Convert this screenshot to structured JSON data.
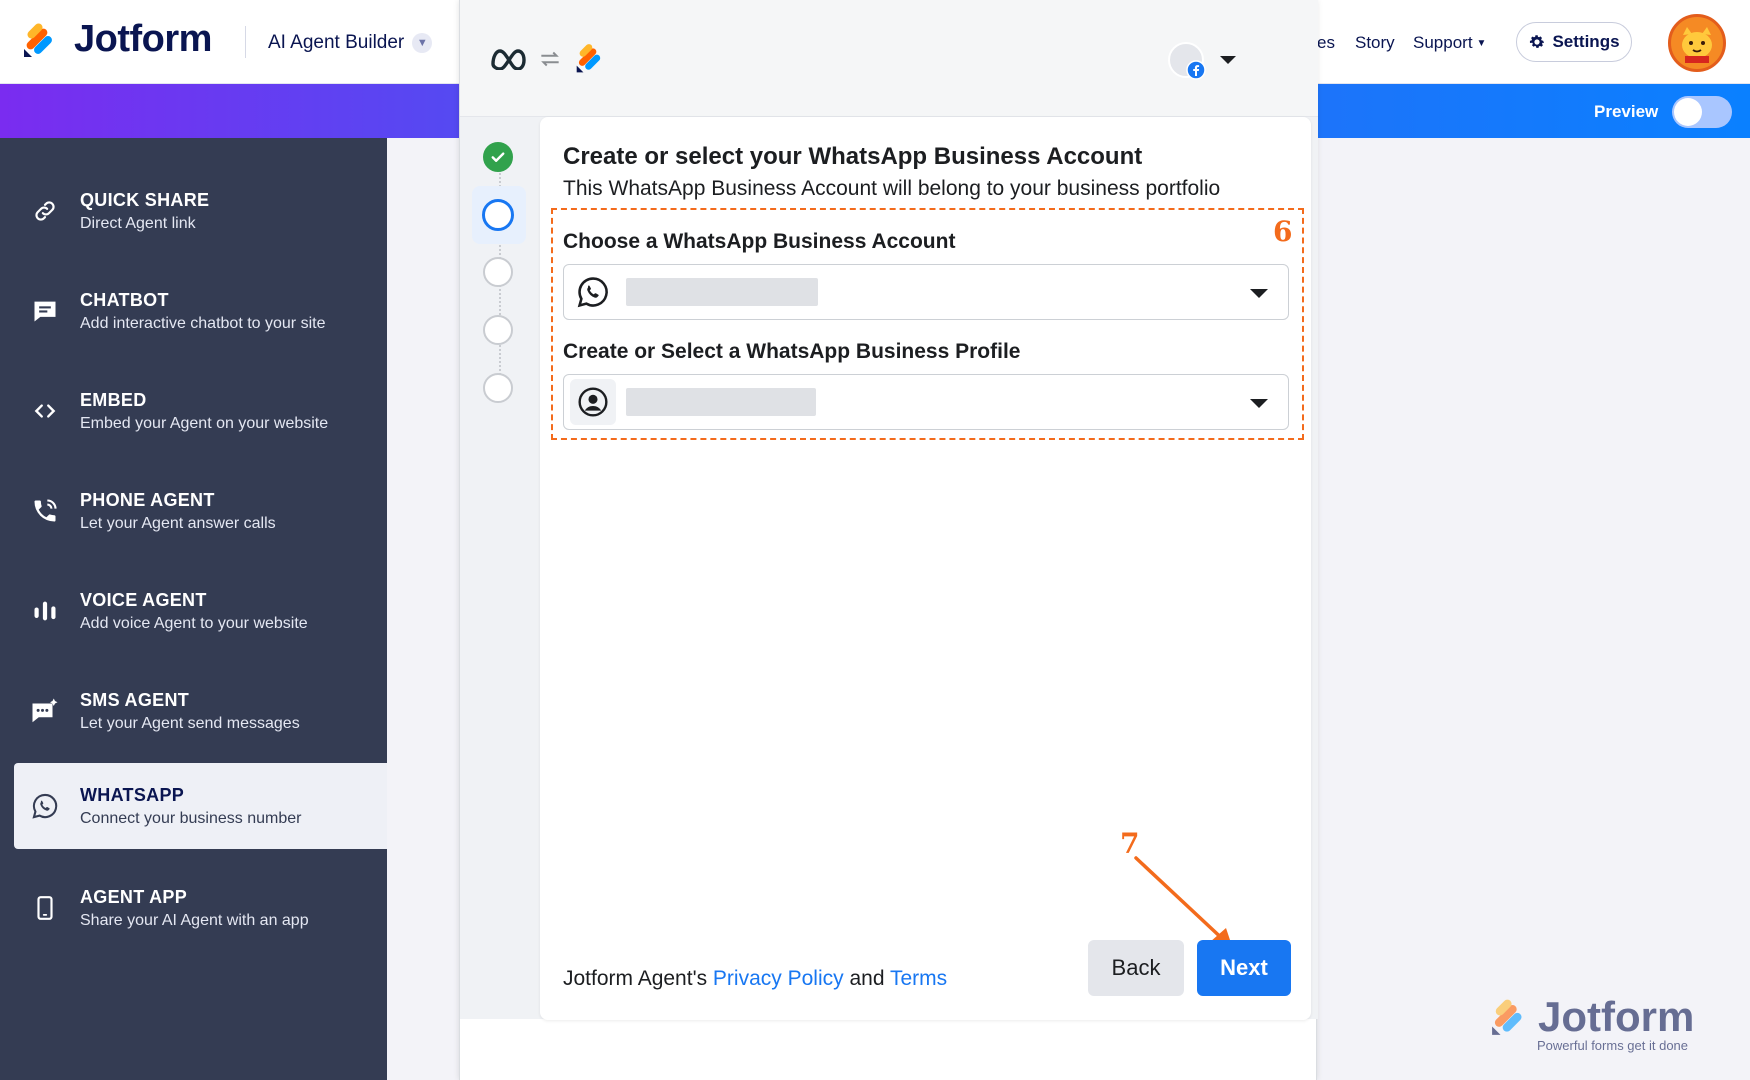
{
  "app": {
    "logo_text": "Jotform",
    "builder_title": "AI Agent Builder"
  },
  "nav": {
    "partial_item": "es",
    "story": "Story",
    "support": "Support",
    "settings": "Settings"
  },
  "banner": {
    "preview_label": "Preview",
    "preview_on": false
  },
  "sidebar": {
    "items": [
      {
        "title": "QUICK SHARE",
        "subtitle": "Direct Agent link",
        "icon": "link-icon",
        "active": false
      },
      {
        "title": "CHATBOT",
        "subtitle": "Add interactive chatbot to your site",
        "icon": "chat-icon",
        "active": false
      },
      {
        "title": "EMBED",
        "subtitle": "Embed your Agent on your website",
        "icon": "code-icon",
        "active": false
      },
      {
        "title": "PHONE AGENT",
        "subtitle": "Let your Agent answer calls",
        "icon": "phone-icon",
        "active": false
      },
      {
        "title": "VOICE AGENT",
        "subtitle": "Add voice Agent to your website",
        "icon": "voice-bars-icon",
        "active": false
      },
      {
        "title": "SMS AGENT",
        "subtitle": "Let your Agent send messages",
        "icon": "sms-icon",
        "active": false
      },
      {
        "title": "WHATSAPP",
        "subtitle": "Connect your business number",
        "icon": "whatsapp-icon",
        "active": true
      },
      {
        "title": "AGENT APP",
        "subtitle": "Share your AI Agent with an app",
        "icon": "mobile-app-icon",
        "active": false
      }
    ]
  },
  "modal": {
    "title": "Create or select your WhatsApp Business Account",
    "subtitle": "This WhatsApp Business Account will belong to your business portfolio",
    "field1_label": "Choose a WhatsApp Business Account",
    "field2_label": "Create or Select a WhatsApp Business Profile",
    "footer_prefix": "Jotform Agent's ",
    "privacy_link": "Privacy Policy",
    "footer_and": " and ",
    "terms_link": "Terms",
    "back_button": "Back",
    "next_button": "Next",
    "steps": [
      "done",
      "active",
      "pending",
      "pending",
      "pending"
    ]
  },
  "annotations": {
    "box_number": "6",
    "arrow_number": "7",
    "color": "#f36b1c"
  },
  "watermark": {
    "text": "Jotform",
    "tagline": "Powerful forms get it done"
  },
  "colors": {
    "sidebar": "#343c53",
    "facebook_blue": "#1877f2",
    "jotform_navy": "#0a1551"
  }
}
